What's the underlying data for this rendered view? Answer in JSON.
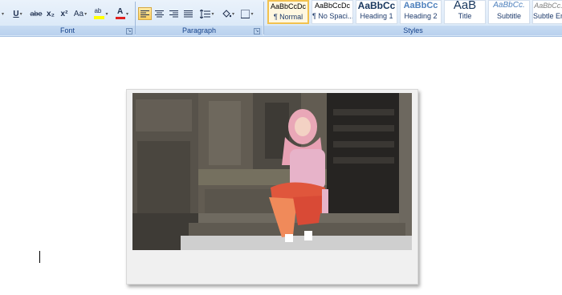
{
  "ribbon": {
    "font": {
      "label": "Font",
      "underline": "U",
      "strikethrough": "abe",
      "subscript": "x₂",
      "superscript": "x²",
      "change_case": "Aa",
      "highlight": "ab",
      "font_color": "A",
      "font_color_hex": "#e02020",
      "highlight_hex": "#ffff00"
    },
    "paragraph": {
      "label": "Paragraph",
      "align_left_active": true
    },
    "styles": {
      "label": "Styles",
      "items": [
        {
          "preview": "AaBbCcDc",
          "name": "¶ Normal",
          "selected": true
        },
        {
          "preview": "AaBbCcDc",
          "name": "¶ No Spaci..."
        },
        {
          "preview": "AaBbCc",
          "name": "Heading 1"
        },
        {
          "preview": "AaBbCc",
          "name": "Heading 2"
        },
        {
          "preview": "AaB",
          "name": "Title"
        },
        {
          "preview": "AaBbCc.",
          "name": "Subtitle"
        },
        {
          "preview": "AaBbCc.",
          "name": "Subtle Em..."
        }
      ]
    }
  }
}
